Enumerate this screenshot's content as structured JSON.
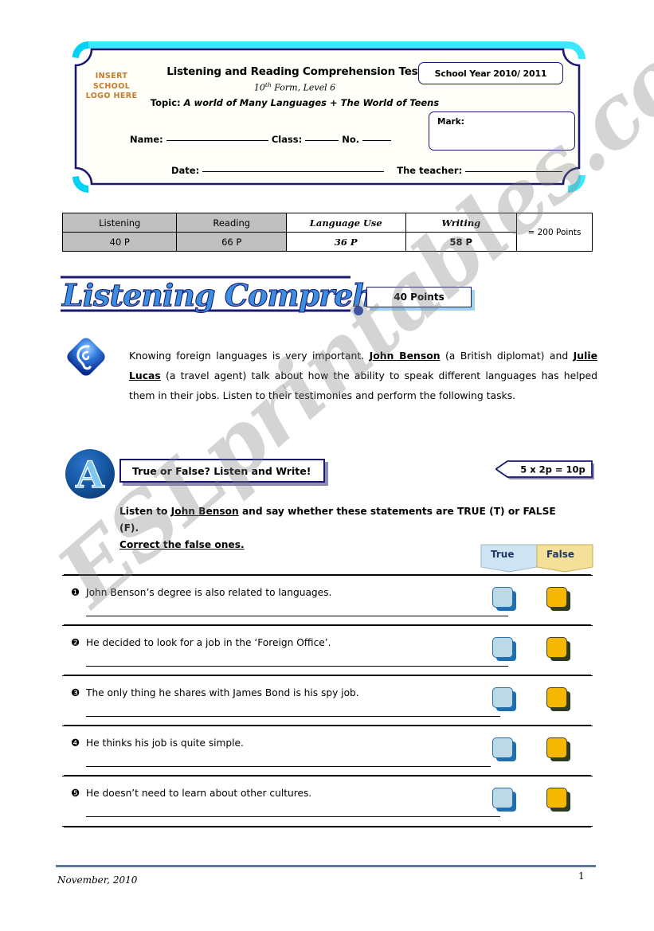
{
  "watermark": {
    "text": "ESLprintables.com"
  },
  "header": {
    "logo_placeholder_line1": "INSERT",
    "logo_placeholder_line2": "SCHOOL",
    "logo_placeholder_line3": "LOGO HERE",
    "title": "Listening and Reading Comprehension Test",
    "subtitle_pre": "10",
    "subtitle_sup": "th",
    "subtitle_post": " Form, Level 6",
    "topic_label": "Topic: ",
    "topic_value": "A world of Many Languages +  The World of Teens",
    "school_year": "School Year 2010/ 2011",
    "mark_label": "Mark:",
    "field_name": "Name:",
    "field_class": "Class:",
    "field_no": "No.",
    "field_date": "Date:",
    "field_teacher": "The teacher:"
  },
  "points_table": {
    "headers": [
      "Listening",
      "Reading",
      "Language Use",
      "Writing"
    ],
    "values": [
      "40 P",
      "66 P",
      "36 P",
      "58 P"
    ],
    "total": "= 200 Points"
  },
  "section": {
    "title": "Listening Comprehension",
    "points_badge": "40 Points"
  },
  "intro": {
    "part1": "Knowing foreign languages is very important.  ",
    "name1": "John Benson",
    "part2": " (a British diplomat) and ",
    "name2": "Julie Lucas",
    "part3": " (a travel agent) talk about how the ability to speak different languages has helped them in their jobs.  Listen to their testimonies and perform the following tasks."
  },
  "task": {
    "icon_letter": "A",
    "heading": "True or False? Listen and Write!",
    "points": "5 x 2p = 10p",
    "instruction_pre": "Listen to ",
    "instruction_name": "John Benson",
    "instruction_post": " and say whether these statements are TRUE (T) or FALSE (F).",
    "instruction_line2": "Correct the false ones."
  },
  "answer_header": {
    "true_label": "True",
    "false_label": "False"
  },
  "questions": [
    {
      "num": "❶",
      "text": "John Benson’s degree is also related to languages.",
      "line_width": 530
    },
    {
      "num": "❷",
      "text": "He decided to look for a job in the ‘Foreign Office’.",
      "line_width": 530
    },
    {
      "num": "❸",
      "text": "The only thing he shares with James Bond is his spy job.",
      "line_width": 520
    },
    {
      "num": "❹",
      "text": "He thinks his job is quite simple.",
      "line_width": 508
    },
    {
      "num": "❺",
      "text": "He doesn’t need to learn about other cultures.",
      "line_width": 520
    }
  ],
  "footer": {
    "date": "November, 2010",
    "page": "1"
  },
  "colors": {
    "navy": "#191970",
    "cyan": "#3ce8ff",
    "orange": "#c47b2a",
    "true_blue": "#bcd9e8",
    "false_gold": "#f5b700",
    "rule_blue": "#5b7b99",
    "table_shade": "#c0c0c0"
  }
}
